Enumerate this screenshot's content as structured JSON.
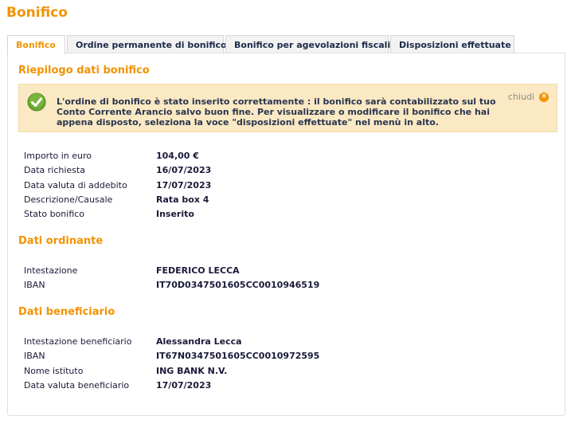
{
  "page": {
    "title": "Bonifico"
  },
  "tabs": [
    {
      "label": "Bonifico",
      "active": true
    },
    {
      "label": "Ordine permanente di bonifico",
      "active": false
    },
    {
      "label": "Bonifico per agevolazioni fiscali",
      "active": false
    },
    {
      "label": "Disposizioni effettuate",
      "active": false
    }
  ],
  "summary": {
    "title": "Riepilogo dati bonifico",
    "alert": {
      "icon": "check-icon",
      "message": "L'ordine di bonifico è stato inserito correttamente : il bonifico sarà contabilizzato sul tuo Conto Corrente Arancio salvo buon fine. Per visualizzare o modificare il bonifico che hai appena disposto, seleziona la voce \"disposizioni effettuate\" nel menù in alto.",
      "close_label": "chiudi"
    },
    "rows": [
      {
        "label": "Importo in euro",
        "value": "104,00 €"
      },
      {
        "label": "Data richiesta",
        "value": "16/07/2023"
      },
      {
        "label": "Data valuta di addebito",
        "value": "17/07/2023"
      },
      {
        "label": "Descrizione/Causale",
        "value": "Rata box 4"
      },
      {
        "label": "Stato bonifico",
        "value": "Inserito"
      }
    ]
  },
  "ordinante": {
    "title": "Dati ordinante",
    "rows": [
      {
        "label": "Intestazione",
        "value": "FEDERICO LECCA"
      },
      {
        "label": "IBAN",
        "value": "IT70D0347501605CC0010946519"
      }
    ]
  },
  "beneficiario": {
    "title": "Dati beneficiario",
    "rows": [
      {
        "label": "Intestazione beneficiario",
        "value": "Alessandra Lecca"
      },
      {
        "label": "IBAN",
        "value": "IT67N0347501605CC0010972595"
      },
      {
        "label": "Nome istituto",
        "value": "ING BANK N.V."
      },
      {
        "label": "Data valuta beneficiario",
        "value": "17/07/2023"
      }
    ]
  },
  "colors": {
    "accent": "#f39200",
    "alert_bg": "#fbe9c3",
    "text": "#1a1a3a",
    "check": "#6aa632"
  }
}
